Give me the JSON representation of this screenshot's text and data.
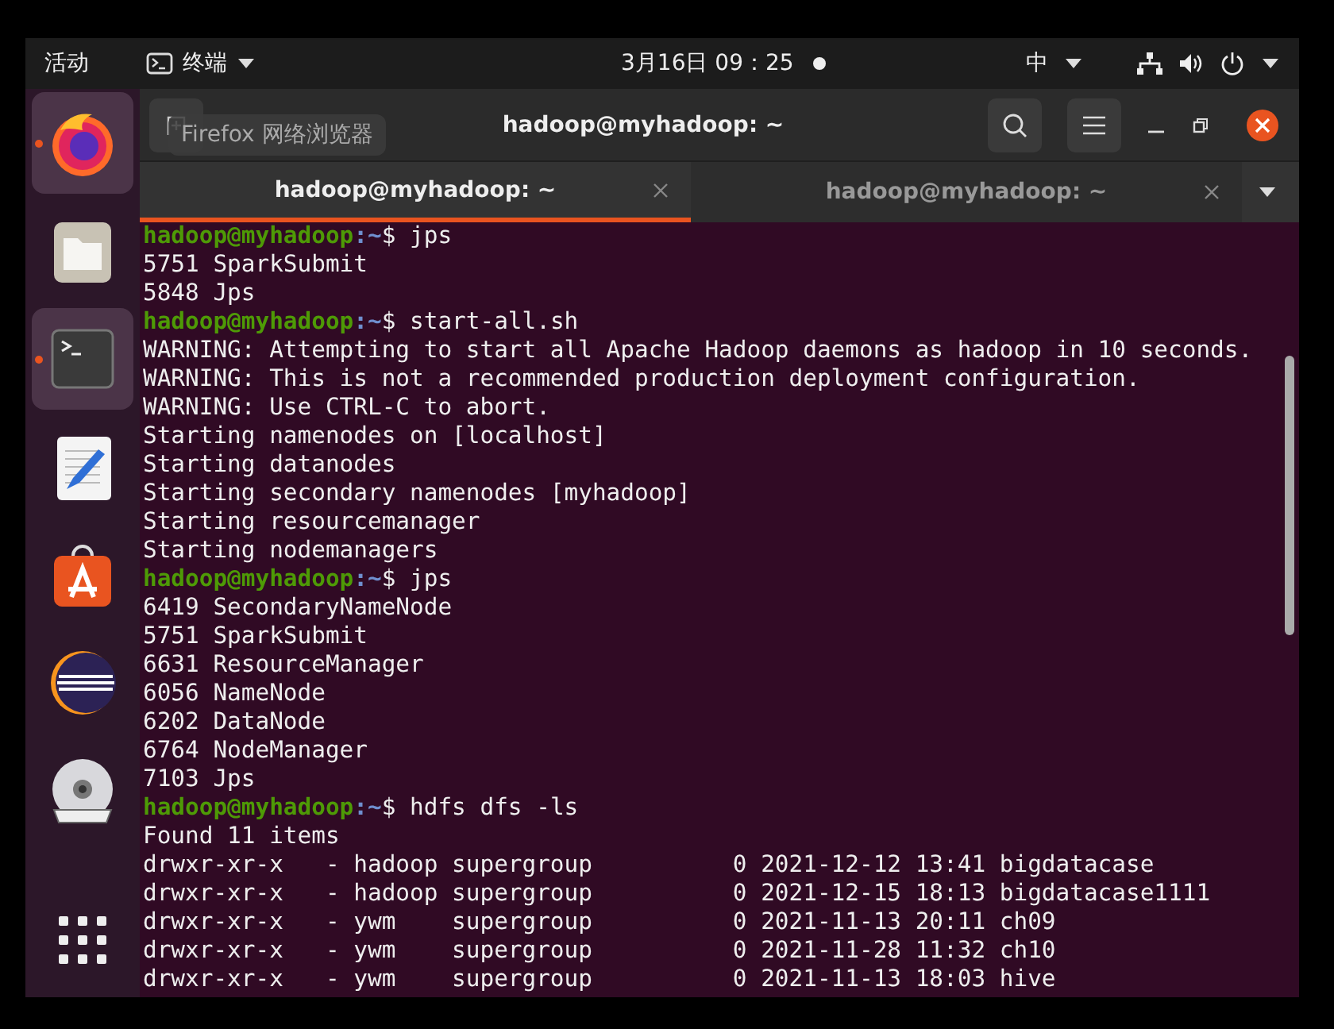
{
  "top_bar": {
    "activities": "活动",
    "app_menu": "终端",
    "clock": "3月16日 09：25",
    "input_method": "中"
  },
  "dock": {
    "items": [
      {
        "kind": "firefox",
        "running": true,
        "highlighted": true
      },
      {
        "kind": "files",
        "running": false,
        "highlighted": false
      },
      {
        "kind": "terminal",
        "running": true,
        "highlighted": true
      },
      {
        "kind": "editor",
        "running": false,
        "highlighted": false
      },
      {
        "kind": "software",
        "running": false,
        "highlighted": false
      },
      {
        "kind": "eclipse",
        "running": false,
        "highlighted": false
      },
      {
        "kind": "dvd",
        "running": false,
        "highlighted": false
      },
      {
        "kind": "apps",
        "running": false,
        "highlighted": false
      }
    ]
  },
  "tooltip": "Firefox 网络浏览器",
  "window": {
    "title": "hadoop@myhadoop: ~"
  },
  "tabs": [
    {
      "label": "hadoop@myhadoop: ~",
      "selected": true
    },
    {
      "label": "hadoop@myhadoop: ~",
      "selected": false
    }
  ],
  "terminal": {
    "lines": [
      {
        "kind": "prompt",
        "user": "hadoop@myhadoop",
        "path": ":~",
        "command": "$ jps"
      },
      {
        "kind": "output",
        "text": "5751 SparkSubmit"
      },
      {
        "kind": "output",
        "text": "5848 Jps"
      },
      {
        "kind": "prompt",
        "user": "hadoop@myhadoop",
        "path": ":~",
        "command": "$ start-all.sh"
      },
      {
        "kind": "output",
        "text": "WARNING: Attempting to start all Apache Hadoop daemons as hadoop in 10 seconds."
      },
      {
        "kind": "output",
        "text": "WARNING: This is not a recommended production deployment configuration."
      },
      {
        "kind": "output",
        "text": "WARNING: Use CTRL-C to abort."
      },
      {
        "kind": "output",
        "text": "Starting namenodes on [localhost]"
      },
      {
        "kind": "output",
        "text": "Starting datanodes"
      },
      {
        "kind": "output",
        "text": "Starting secondary namenodes [myhadoop]"
      },
      {
        "kind": "output",
        "text": "Starting resourcemanager"
      },
      {
        "kind": "output",
        "text": "Starting nodemanagers"
      },
      {
        "kind": "prompt",
        "user": "hadoop@myhadoop",
        "path": ":~",
        "command": "$ jps"
      },
      {
        "kind": "output",
        "text": "6419 SecondaryNameNode"
      },
      {
        "kind": "output",
        "text": "5751 SparkSubmit"
      },
      {
        "kind": "output",
        "text": "6631 ResourceManager"
      },
      {
        "kind": "output",
        "text": "6056 NameNode"
      },
      {
        "kind": "output",
        "text": "6202 DataNode"
      },
      {
        "kind": "output",
        "text": "6764 NodeManager"
      },
      {
        "kind": "output",
        "text": "7103 Jps"
      },
      {
        "kind": "prompt",
        "user": "hadoop@myhadoop",
        "path": ":~",
        "command": "$ hdfs dfs -ls"
      },
      {
        "kind": "output",
        "text": "Found 11 items"
      },
      {
        "kind": "output",
        "text": "drwxr-xr-x   - hadoop supergroup          0 2021-12-12 13:41 bigdatacase"
      },
      {
        "kind": "output",
        "text": "drwxr-xr-x   - hadoop supergroup          0 2021-12-15 18:13 bigdatacase1111"
      },
      {
        "kind": "output",
        "text": "drwxr-xr-x   - ywm    supergroup          0 2021-11-13 20:11 ch09"
      },
      {
        "kind": "output",
        "text": "drwxr-xr-x   - ywm    supergroup          0 2021-11-28 11:32 ch10"
      },
      {
        "kind": "output",
        "text": "drwxr-xr-x   - ywm    supergroup          0 2021-11-13 18:03 hive"
      }
    ]
  }
}
